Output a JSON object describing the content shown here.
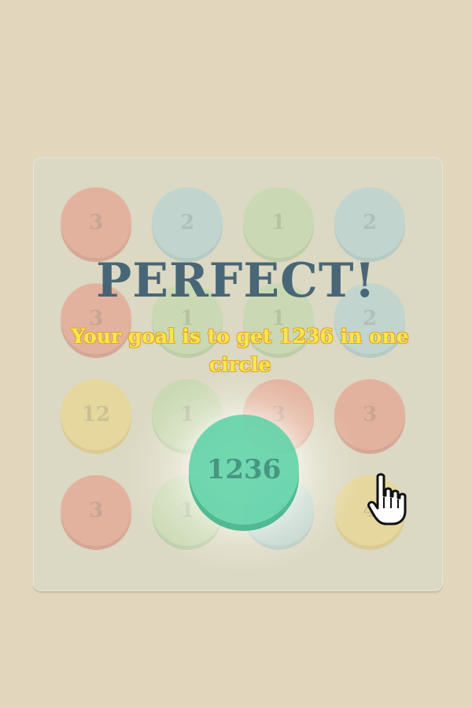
{
  "board": {
    "rows": [
      [
        {
          "value": "3",
          "color": "red"
        },
        {
          "value": "2",
          "color": "blue"
        },
        {
          "value": "1",
          "color": "green"
        },
        {
          "value": "2",
          "color": "blue"
        }
      ],
      [
        {
          "value": "3",
          "color": "red"
        },
        {
          "value": "1",
          "color": "green"
        },
        {
          "value": "1",
          "color": "green"
        },
        {
          "value": "2",
          "color": "blue"
        }
      ],
      [
        {
          "value": "12",
          "color": "yellow"
        },
        {
          "value": "1",
          "color": "green"
        },
        {
          "value": "3",
          "color": "red"
        },
        {
          "value": "3",
          "color": "red"
        }
      ],
      [
        {
          "value": "3",
          "color": "red"
        },
        {
          "value": "1",
          "color": "green"
        },
        {
          "value": "2",
          "color": "blue"
        },
        {
          "value": "4",
          "color": "yellow"
        }
      ]
    ]
  },
  "message": {
    "headline": "PERFECT!",
    "goal": "Your goal is to get 1236 in one circle"
  },
  "merged": {
    "value": "1236",
    "color": "#5fd4a9"
  },
  "cursor": {
    "icon": "hand-pointer-icon"
  },
  "colors": {
    "background": "#e2d6bd",
    "board": "#dbd8c3",
    "red": "#ec7e6c",
    "blue": "#9fd3df",
    "green": "#b3dba0",
    "yellow": "#f6d76d",
    "headline": "#3d5d70",
    "goal_text": "#f5e84c"
  }
}
